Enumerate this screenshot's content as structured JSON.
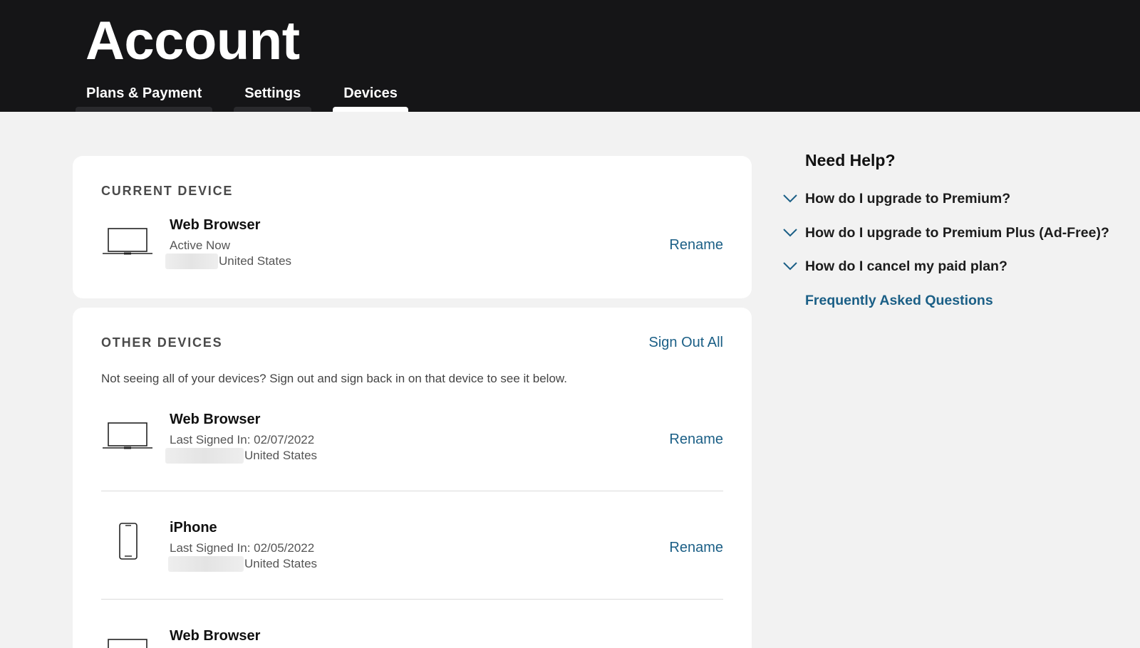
{
  "header": {
    "title": "Account",
    "tabs": [
      {
        "label": "Plans & Payment",
        "active": false
      },
      {
        "label": "Settings",
        "active": false
      },
      {
        "label": "Devices",
        "active": true
      }
    ]
  },
  "current_device": {
    "heading": "CURRENT DEVICE",
    "device": {
      "icon": "laptop-icon",
      "name": "Web Browser",
      "status": "Active Now",
      "location": "United States",
      "action": "Rename"
    }
  },
  "other_devices": {
    "heading": "OTHER DEVICES",
    "sign_out_all": "Sign Out All",
    "note": "Not seeing all of your devices? Sign out and sign back in on that device to see it below.",
    "devices": [
      {
        "icon": "laptop-icon",
        "name": "Web Browser",
        "status": "Last Signed In: 02/07/2022",
        "location": "United States",
        "action": "Rename"
      },
      {
        "icon": "phone-icon",
        "name": "iPhone",
        "status": "Last Signed In: 02/05/2022",
        "location": "United States",
        "action": "Rename"
      },
      {
        "icon": "laptop-icon",
        "name": "Web Browser"
      }
    ]
  },
  "help": {
    "title": "Need Help?",
    "faqs": [
      "How do I upgrade to Premium?",
      "How do I upgrade to Premium Plus (Ad-Free)?",
      "How do I cancel my paid plan?"
    ],
    "faq_link": "Frequently Asked Questions"
  },
  "colors": {
    "header_bg": "#151517",
    "page_bg": "#f2f2f2",
    "link": "#1b5f86",
    "card_bg": "#ffffff"
  }
}
